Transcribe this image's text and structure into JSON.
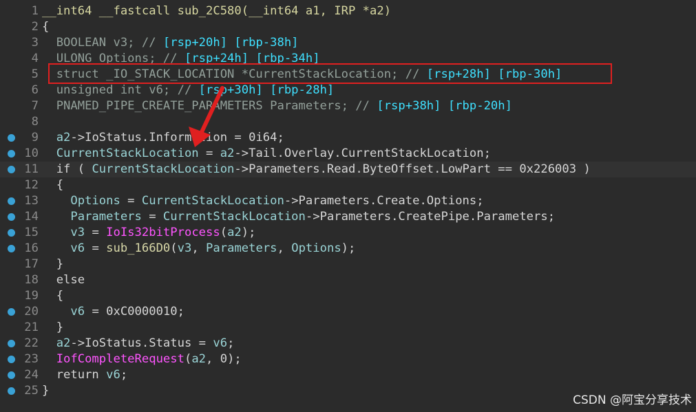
{
  "breakpoint_color": "#3aa2d6",
  "highlight_color": "#e02020",
  "watermark": "CSDN @阿宝分享技术",
  "lines": [
    {
      "n": "1",
      "bp": false,
      "toks": [
        [
          "t-y",
          "__int64 __fastcall sub_2C580(__int64 a1, IRP *a2)"
        ]
      ]
    },
    {
      "n": "2",
      "bp": false,
      "toks": [
        [
          "t-d",
          "{"
        ]
      ]
    },
    {
      "n": "3",
      "bp": false,
      "toks": [
        [
          "t-g",
          "  BOOLEAN v3; // "
        ],
        [
          "t-b",
          "[rsp+20h] [rbp-38h]"
        ]
      ]
    },
    {
      "n": "4",
      "bp": false,
      "toks": [
        [
          "t-g",
          "  ULONG Options; // "
        ],
        [
          "t-b",
          "[rsp+24h] [rbp-34h]"
        ]
      ]
    },
    {
      "n": "5",
      "bp": false,
      "toks": [
        [
          "t-g",
          "  struct _IO_STACK_LOCATION *CurrentStackLocation; // "
        ],
        [
          "t-b",
          "[rsp+28h] [rbp-30h]"
        ]
      ]
    },
    {
      "n": "6",
      "bp": false,
      "toks": [
        [
          "t-g",
          "  unsigned int v6; // "
        ],
        [
          "t-b",
          "[rsp+30h] [rbp-28h]"
        ]
      ]
    },
    {
      "n": "7",
      "bp": false,
      "toks": [
        [
          "t-g",
          "  PNAMED_PIPE_CREATE_PARAMETERS Parameters; // "
        ],
        [
          "t-b",
          "[rsp+38h] [rbp-20h]"
        ]
      ]
    },
    {
      "n": "8",
      "bp": false,
      "toks": [
        [
          "t-d",
          ""
        ]
      ]
    },
    {
      "n": "9",
      "bp": true,
      "toks": [
        [
          "t-c",
          "  a2"
        ],
        [
          "t-d",
          "->IoStatus.Information = 0i64;"
        ]
      ]
    },
    {
      "n": "10",
      "bp": true,
      "toks": [
        [
          "t-c",
          "  CurrentStackLocation"
        ],
        [
          "t-d",
          " = "
        ],
        [
          "t-c",
          "a2"
        ],
        [
          "t-d",
          "->Tail.Overlay.CurrentStackLocation;"
        ]
      ]
    },
    {
      "n": "11",
      "bp": true,
      "cur": true,
      "toks": [
        [
          "t-d",
          "  if ( "
        ],
        [
          "t-c",
          "CurrentStackLocation"
        ],
        [
          "t-d",
          "->Parameters.Read.ByteOffset.LowPart == 0x226003 )"
        ]
      ]
    },
    {
      "n": "12",
      "bp": false,
      "toks": [
        [
          "t-d",
          "  {"
        ]
      ]
    },
    {
      "n": "13",
      "bp": true,
      "toks": [
        [
          "t-c",
          "    Options"
        ],
        [
          "t-d",
          " = "
        ],
        [
          "t-c",
          "CurrentStackLocation"
        ],
        [
          "t-d",
          "->Parameters.Create.Options;"
        ]
      ]
    },
    {
      "n": "14",
      "bp": true,
      "toks": [
        [
          "t-c",
          "    Parameters"
        ],
        [
          "t-d",
          " = "
        ],
        [
          "t-c",
          "CurrentStackLocation"
        ],
        [
          "t-d",
          "->Parameters.CreatePipe.Parameters;"
        ]
      ]
    },
    {
      "n": "15",
      "bp": true,
      "toks": [
        [
          "t-c",
          "    v3"
        ],
        [
          "t-d",
          " = "
        ],
        [
          "t-p",
          "IoIs32bitProcess"
        ],
        [
          "t-d",
          "("
        ],
        [
          "t-c",
          "a2"
        ],
        [
          "t-d",
          ");"
        ]
      ]
    },
    {
      "n": "16",
      "bp": true,
      "toks": [
        [
          "t-c",
          "    v6"
        ],
        [
          "t-d",
          " = "
        ],
        [
          "t-v",
          "sub_166D0"
        ],
        [
          "t-d",
          "("
        ],
        [
          "t-c",
          "v3"
        ],
        [
          "t-d",
          ", "
        ],
        [
          "t-c",
          "Parameters"
        ],
        [
          "t-d",
          ", "
        ],
        [
          "t-c",
          "Options"
        ],
        [
          "t-d",
          ");"
        ]
      ]
    },
    {
      "n": "17",
      "bp": false,
      "toks": [
        [
          "t-d",
          "  }"
        ]
      ]
    },
    {
      "n": "18",
      "bp": false,
      "toks": [
        [
          "t-d",
          "  else"
        ]
      ]
    },
    {
      "n": "19",
      "bp": false,
      "toks": [
        [
          "t-d",
          "  {"
        ]
      ]
    },
    {
      "n": "20",
      "bp": true,
      "toks": [
        [
          "t-c",
          "    v6"
        ],
        [
          "t-d",
          " = 0xC0000010;"
        ]
      ]
    },
    {
      "n": "21",
      "bp": false,
      "toks": [
        [
          "t-d",
          "  }"
        ]
      ]
    },
    {
      "n": "22",
      "bp": true,
      "toks": [
        [
          "t-c",
          "  a2"
        ],
        [
          "t-d",
          "->IoStatus.Status = "
        ],
        [
          "t-c",
          "v6"
        ],
        [
          "t-d",
          ";"
        ]
      ]
    },
    {
      "n": "23",
      "bp": true,
      "toks": [
        [
          "t-p",
          "  IofCompleteRequest"
        ],
        [
          "t-d",
          "("
        ],
        [
          "t-c",
          "a2"
        ],
        [
          "t-d",
          ", 0);"
        ]
      ]
    },
    {
      "n": "24",
      "bp": true,
      "toks": [
        [
          "t-d",
          "  return "
        ],
        [
          "t-c",
          "v6"
        ],
        [
          "t-d",
          ";"
        ]
      ]
    },
    {
      "n": "25",
      "bp": true,
      "toks": [
        [
          "t-d",
          "}"
        ]
      ]
    }
  ]
}
